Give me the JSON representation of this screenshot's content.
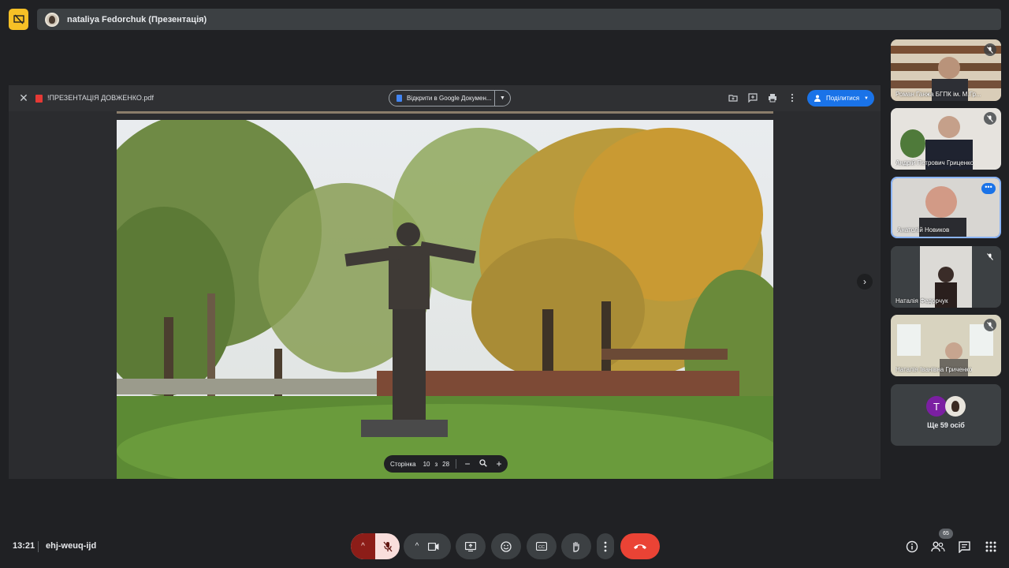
{
  "presenter": {
    "name": "nataliya Fedorchuk (Презентація)"
  },
  "viewer": {
    "file_name": "!ПРЕЗЕНТАЦІЯ ДОВЖЕНКО.pdf",
    "open_in_docs_label": "Відкрити в Google Докумен...",
    "share_label": "Поділитися",
    "page_controls": {
      "label": "Сторінка",
      "current": "10",
      "of": "з",
      "total": "28"
    }
  },
  "participants": [
    {
      "name": "Роман Ганжа БГПК ім. М.Гр...",
      "muted": true
    },
    {
      "name": "Андрій Петрович Гриценко",
      "muted": true
    },
    {
      "name": "Анатолій Новиков",
      "muted": false,
      "speaking": true
    },
    {
      "name": "Наталія Федорчук",
      "muted": true
    },
    {
      "name": "Наталія Іванівна Гриченко",
      "muted": true
    }
  ],
  "more_people": {
    "initial": "T",
    "label": "Ще 59 осіб"
  },
  "bottom": {
    "time": "13:21",
    "meeting_code": "ehj-weuq-ijd",
    "people_count": "65"
  },
  "colors": {
    "background": "#202124",
    "accent": "#1a73e8",
    "end_call": "#ea4335",
    "mic_off_bg": "#f9dedc",
    "present_badge": "#f6c026"
  }
}
